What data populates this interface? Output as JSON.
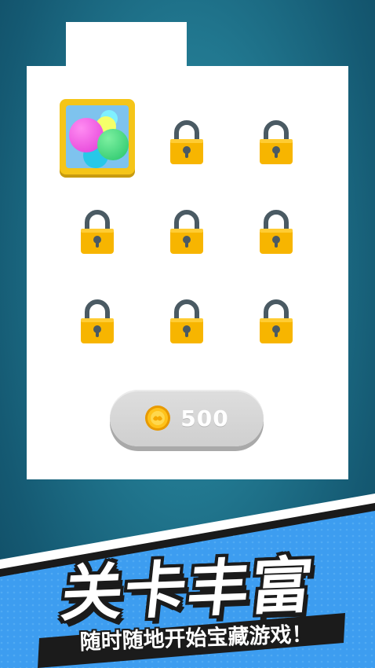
{
  "level_select": {
    "cells": [
      {
        "state": "unlocked",
        "skin": "colorful-balls"
      },
      {
        "state": "locked"
      },
      {
        "state": "locked"
      },
      {
        "state": "locked"
      },
      {
        "state": "locked"
      },
      {
        "state": "locked"
      },
      {
        "state": "locked"
      },
      {
        "state": "locked"
      },
      {
        "state": "locked"
      }
    ],
    "unlock_button": {
      "amount": "500",
      "icon": "gold-coin-icon"
    }
  },
  "banner": {
    "title": "关卡丰富",
    "subtitle": "随时随地开始宝藏游戏！"
  },
  "colors": {
    "background": "#21778f",
    "panel": "#ffffff",
    "lock_body": "#f7b500",
    "lock_shackle": "#4a5a63",
    "card_border": "#f5c518",
    "banner_blue": "#3d9df0",
    "coin": "#f5b800"
  }
}
